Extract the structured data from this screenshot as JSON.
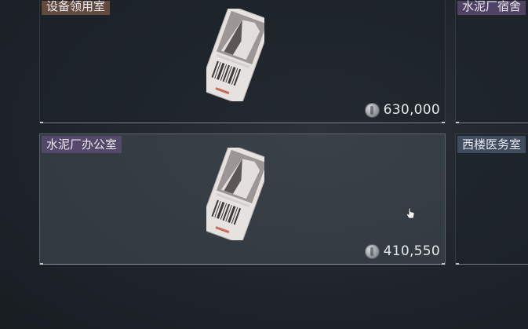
{
  "items": [
    {
      "name": "设备领用室",
      "price": "630,000",
      "tag_color": "#6e5242"
    },
    {
      "name": "水泥厂宿舍",
      "price": "",
      "tag_color": "#604e78"
    },
    {
      "name": "水泥厂办公室",
      "price": "410,550",
      "tag_color": "#604e78"
    },
    {
      "name": "西楼医务室",
      "price": "",
      "tag_color": "#46546a"
    }
  ],
  "currency_icon": "silver-coin-icon",
  "item_icon": "keycard-icon"
}
